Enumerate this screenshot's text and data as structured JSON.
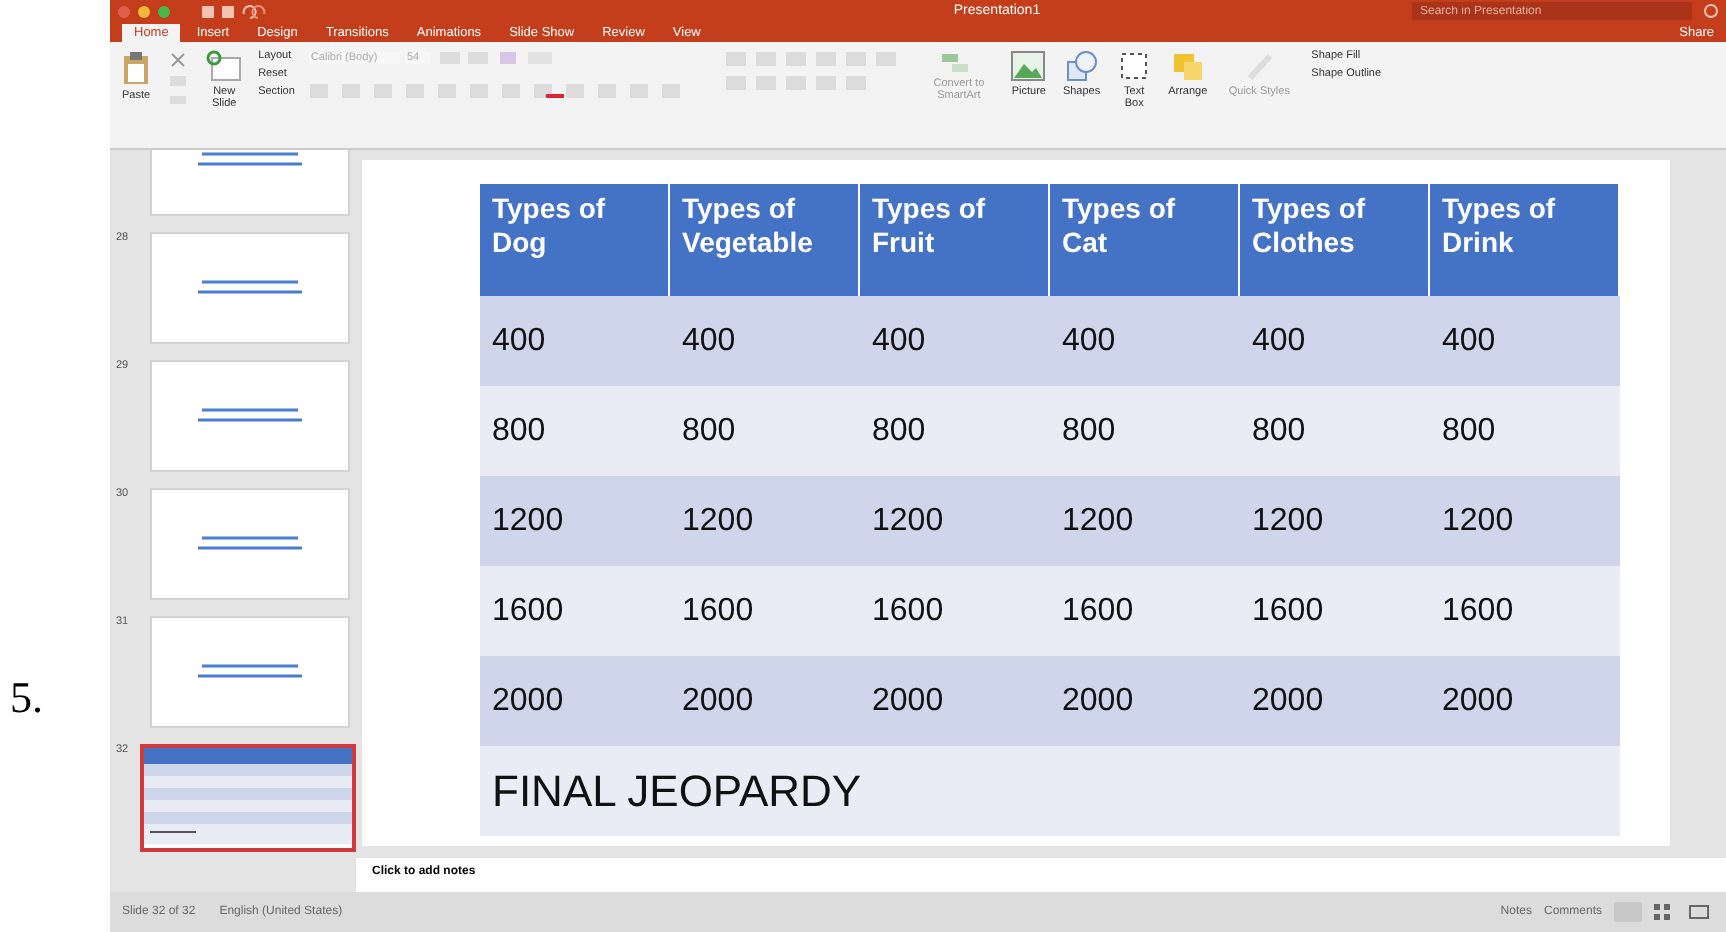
{
  "step": "5.",
  "window": {
    "title": "Presentation1"
  },
  "search": {
    "placeholder": "Search in Presentation"
  },
  "share": "Share",
  "tabs": [
    {
      "label": "Home",
      "selected": true
    },
    {
      "label": "Insert",
      "selected": false
    },
    {
      "label": "Design",
      "selected": false
    },
    {
      "label": "Transitions",
      "selected": false
    },
    {
      "label": "Animations",
      "selected": false
    },
    {
      "label": "Slide Show",
      "selected": false
    },
    {
      "label": "Review",
      "selected": false
    },
    {
      "label": "View",
      "selected": false
    }
  ],
  "ribbon": {
    "paste": "Paste",
    "new_slide": "New Slide",
    "slide_menu": [
      "Layout",
      "Reset",
      "Section"
    ],
    "font": "Calibri (Body)",
    "font_size": "54",
    "smartart": "Convert to SmartArt",
    "insert_buttons": [
      "Picture",
      "Shapes",
      "Text Box"
    ],
    "arrange": "Arrange",
    "quick_styles": "Quick Styles",
    "shape_menu": [
      "Shape Fill",
      "Shape Outline"
    ]
  },
  "slides": [
    {
      "kind": "text",
      "selected": false
    },
    {
      "number": "28",
      "kind": "text",
      "selected": false
    },
    {
      "number": "29",
      "kind": "text",
      "selected": false
    },
    {
      "number": "30",
      "kind": "text",
      "selected": false
    },
    {
      "number": "31",
      "kind": "text",
      "selected": false
    },
    {
      "number": "32",
      "kind": "table",
      "selected": true
    }
  ],
  "table": {
    "columns": [
      "Types of Dog",
      "Types of Vegetable",
      "Types of Fruit",
      "Types of Cat",
      "Types of Clothes",
      "Types of Drink"
    ],
    "rows": [
      [
        "400",
        "400",
        "400",
        "400",
        "400",
        "400"
      ],
      [
        "800",
        "800",
        "800",
        "800",
        "800",
        "800"
      ],
      [
        "1200",
        "1200",
        "1200",
        "1200",
        "1200",
        "1200"
      ],
      [
        "1600",
        "1600",
        "1600",
        "1600",
        "1600",
        "1600"
      ],
      [
        "2000",
        "2000",
        "2000",
        "2000",
        "2000",
        "2000"
      ]
    ],
    "final": "FINAL JEOPARDY"
  },
  "notes": {
    "placeholder": "Click to add notes"
  },
  "status_bar": {
    "slide": "Slide 32 of 32",
    "language": "English (United States)",
    "buttons": [
      "Notes",
      "Comments"
    ]
  }
}
